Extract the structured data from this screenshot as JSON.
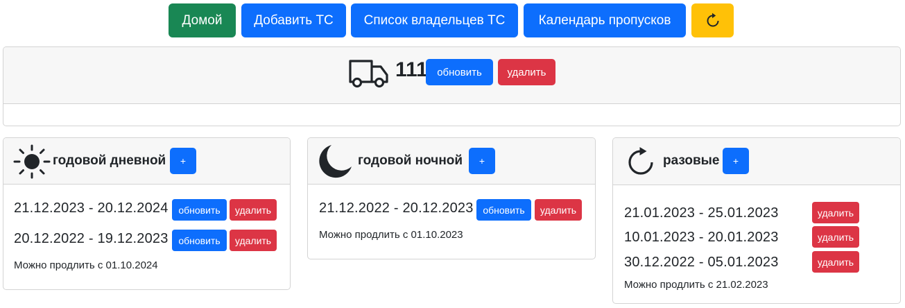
{
  "nav": {
    "home": "Домой",
    "add_vehicle": "Добавить ТС",
    "owners_list": "Список владельцев ТС",
    "passes_calendar": "Календарь пропусков",
    "refresh_icon": "arrow-clockwise-icon"
  },
  "vehicle": {
    "icon": "truck-icon",
    "number": "111",
    "update_label": "обновить",
    "delete_label": "удалить"
  },
  "cards": {
    "annual_day": {
      "icon": "sun-icon",
      "title": "годовой дневной",
      "add_label": "+",
      "passes": [
        {
          "range": "21.12.2023 - 20.12.2024",
          "update_label": "обновить",
          "delete_label": "удалить"
        },
        {
          "range": "20.12.2022 - 19.12.2023",
          "update_label": "обновить",
          "delete_label": "удалить"
        }
      ],
      "renew_note": "Можно продлить с 01.10.2024"
    },
    "annual_night": {
      "icon": "moon-icon",
      "title": "годовой ночной",
      "add_label": "+",
      "passes": [
        {
          "range": "21.12.2022 - 20.12.2023",
          "update_label": "обновить",
          "delete_label": "удалить"
        }
      ],
      "renew_note": "Можно продлить с 01.10.2023"
    },
    "one_time": {
      "icon": "arrow-clockwise-icon",
      "title": "разовые",
      "add_label": "+",
      "passes": [
        {
          "range": "21.01.2023 - 25.01.2023",
          "delete_label": "удалить"
        },
        {
          "range": "10.01.2023 - 20.01.2023",
          "delete_label": "удалить"
        },
        {
          "range": "30.12.2022 - 05.01.2023",
          "delete_label": "удалить"
        }
      ],
      "renew_note": "Можно продлить с 21.02.2023"
    }
  },
  "colors": {
    "primary": "#0d6efd",
    "success": "#198754",
    "danger": "#dc3545",
    "warning": "#ffc107",
    "icon_dark": "#212529"
  }
}
